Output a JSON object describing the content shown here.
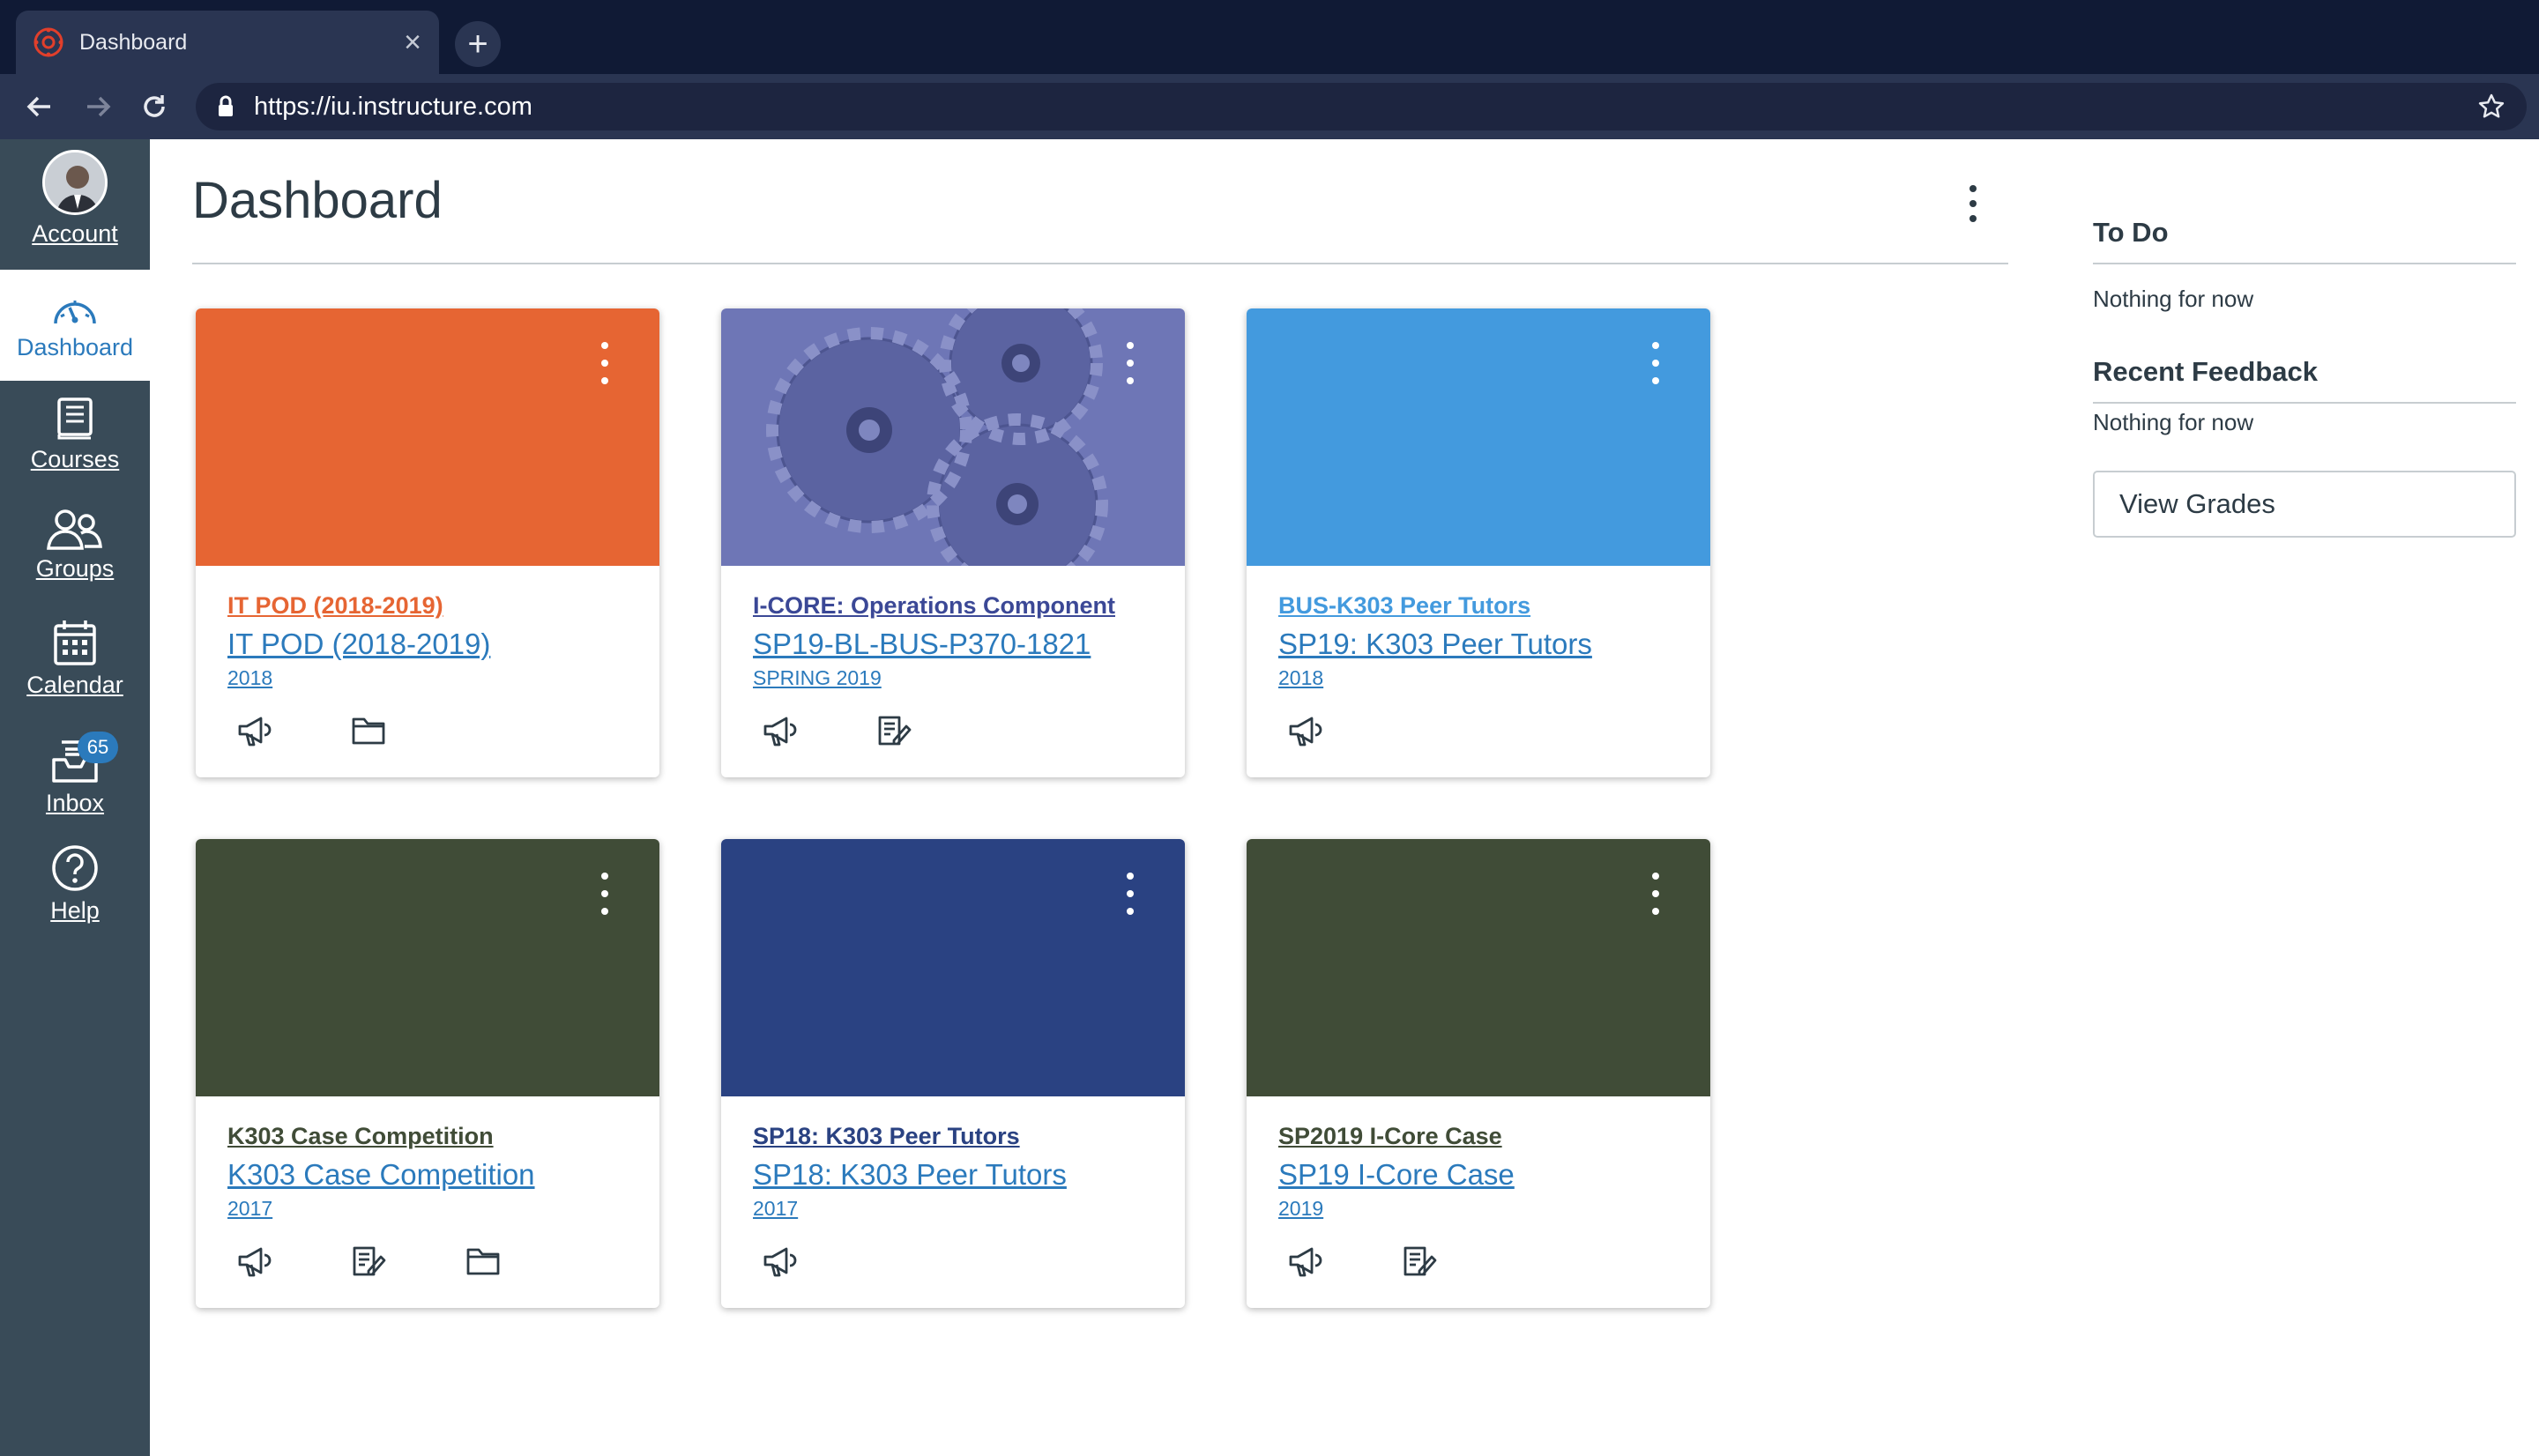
{
  "browser": {
    "tab_title": "Dashboard",
    "tab_close": "×",
    "new_tab": "+",
    "url": "https://iu.instructure.com"
  },
  "global_nav": {
    "account": "Account",
    "dashboard": "Dashboard",
    "courses": "Courses",
    "groups": "Groups",
    "calendar": "Calendar",
    "inbox": "Inbox",
    "inbox_badge": "65",
    "help": "Help"
  },
  "page": {
    "title": "Dashboard"
  },
  "cards": [
    {
      "title": "IT POD (2018-2019)",
      "code": "IT POD (2018-2019)",
      "term": "2018",
      "color": "#e66533",
      "title_color": "#e66533",
      "icons": [
        "announcements-icon",
        "files-icon"
      ]
    },
    {
      "title": "I-CORE: Operations Component",
      "code": "SP19-BL-BUS-P370-1821",
      "term": "SPRING 2019",
      "color": "#6e76b6",
      "title_color": "#3b4896",
      "icons": [
        "announcements-icon",
        "assignments-icon"
      ]
    },
    {
      "title": "BUS-K303 Peer Tutors",
      "code": "SP19: K303 Peer Tutors",
      "term": "2018",
      "color": "#439ade",
      "title_color": "#439ade",
      "icons": [
        "announcements-icon"
      ]
    },
    {
      "title": "K303 Case Competition",
      "code": "K303 Case Competition",
      "term": "2017",
      "color": "#404c37",
      "title_color": "#404c37",
      "icons": [
        "announcements-icon",
        "assignments-icon",
        "files-icon"
      ]
    },
    {
      "title": "SP18: K303 Peer Tutors",
      "code": "SP18: K303 Peer Tutors",
      "term": "2017",
      "color": "#2a4282",
      "title_color": "#2a4282",
      "icons": [
        "announcements-icon"
      ]
    },
    {
      "title": "SP2019 I-Core Case",
      "code": "SP19 I-Core Case",
      "term": "2019",
      "color": "#404c37",
      "title_color": "#404c37",
      "icons": [
        "announcements-icon",
        "assignments-icon"
      ]
    }
  ],
  "sidebar": {
    "todo_heading": "To Do",
    "todo_empty": "Nothing for now",
    "feedback_heading": "Recent Feedback",
    "feedback_empty": "Nothing for now",
    "view_grades": "View Grades"
  },
  "colors": {
    "chrome_bg": "#101a35",
    "nav_bg": "#394b58",
    "link_blue": "#2b7abc",
    "text_dark": "#2d3b45"
  }
}
